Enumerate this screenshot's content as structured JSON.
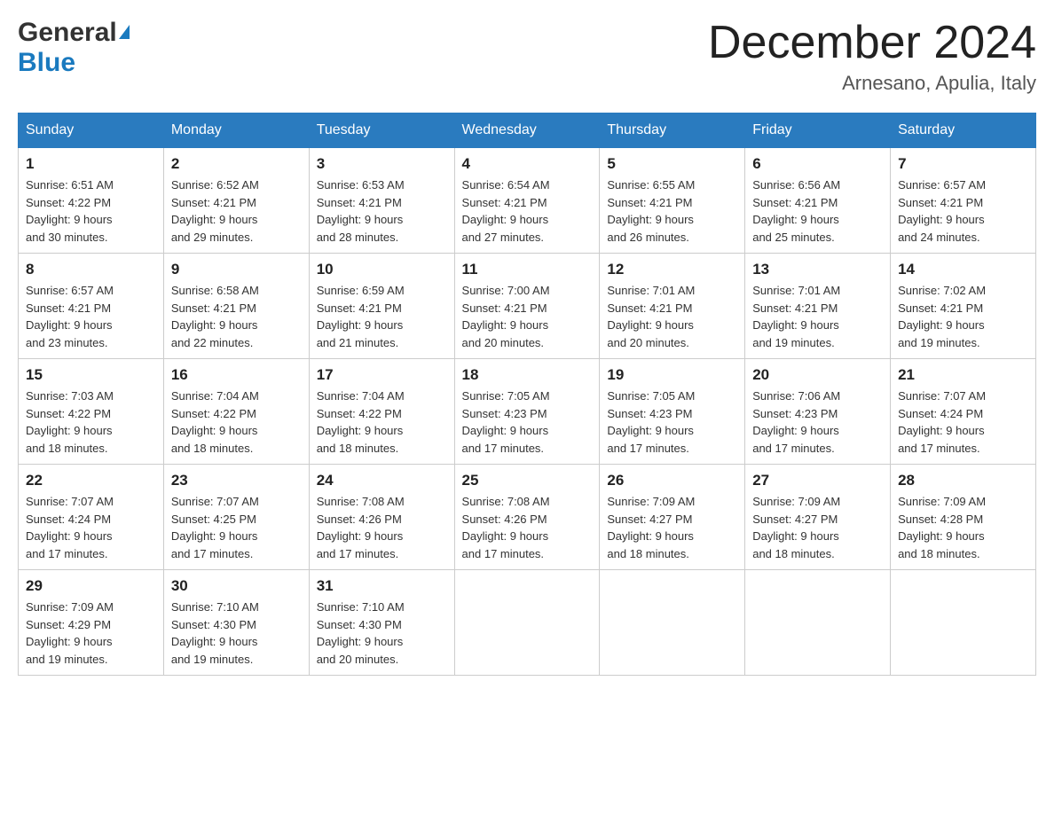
{
  "header": {
    "logo_general": "General",
    "logo_blue": "Blue",
    "month_title": "December 2024",
    "location": "Arnesano, Apulia, Italy"
  },
  "days_of_week": [
    "Sunday",
    "Monday",
    "Tuesday",
    "Wednesday",
    "Thursday",
    "Friday",
    "Saturday"
  ],
  "weeks": [
    [
      {
        "day": "1",
        "sunrise": "6:51 AM",
        "sunset": "4:22 PM",
        "daylight": "9 hours and 30 minutes."
      },
      {
        "day": "2",
        "sunrise": "6:52 AM",
        "sunset": "4:21 PM",
        "daylight": "9 hours and 29 minutes."
      },
      {
        "day": "3",
        "sunrise": "6:53 AM",
        "sunset": "4:21 PM",
        "daylight": "9 hours and 28 minutes."
      },
      {
        "day": "4",
        "sunrise": "6:54 AM",
        "sunset": "4:21 PM",
        "daylight": "9 hours and 27 minutes."
      },
      {
        "day": "5",
        "sunrise": "6:55 AM",
        "sunset": "4:21 PM",
        "daylight": "9 hours and 26 minutes."
      },
      {
        "day": "6",
        "sunrise": "6:56 AM",
        "sunset": "4:21 PM",
        "daylight": "9 hours and 25 minutes."
      },
      {
        "day": "7",
        "sunrise": "6:57 AM",
        "sunset": "4:21 PM",
        "daylight": "9 hours and 24 minutes."
      }
    ],
    [
      {
        "day": "8",
        "sunrise": "6:57 AM",
        "sunset": "4:21 PM",
        "daylight": "9 hours and 23 minutes."
      },
      {
        "day": "9",
        "sunrise": "6:58 AM",
        "sunset": "4:21 PM",
        "daylight": "9 hours and 22 minutes."
      },
      {
        "day": "10",
        "sunrise": "6:59 AM",
        "sunset": "4:21 PM",
        "daylight": "9 hours and 21 minutes."
      },
      {
        "day": "11",
        "sunrise": "7:00 AM",
        "sunset": "4:21 PM",
        "daylight": "9 hours and 20 minutes."
      },
      {
        "day": "12",
        "sunrise": "7:01 AM",
        "sunset": "4:21 PM",
        "daylight": "9 hours and 20 minutes."
      },
      {
        "day": "13",
        "sunrise": "7:01 AM",
        "sunset": "4:21 PM",
        "daylight": "9 hours and 19 minutes."
      },
      {
        "day": "14",
        "sunrise": "7:02 AM",
        "sunset": "4:21 PM",
        "daylight": "9 hours and 19 minutes."
      }
    ],
    [
      {
        "day": "15",
        "sunrise": "7:03 AM",
        "sunset": "4:22 PM",
        "daylight": "9 hours and 18 minutes."
      },
      {
        "day": "16",
        "sunrise": "7:04 AM",
        "sunset": "4:22 PM",
        "daylight": "9 hours and 18 minutes."
      },
      {
        "day": "17",
        "sunrise": "7:04 AM",
        "sunset": "4:22 PM",
        "daylight": "9 hours and 18 minutes."
      },
      {
        "day": "18",
        "sunrise": "7:05 AM",
        "sunset": "4:23 PM",
        "daylight": "9 hours and 17 minutes."
      },
      {
        "day": "19",
        "sunrise": "7:05 AM",
        "sunset": "4:23 PM",
        "daylight": "9 hours and 17 minutes."
      },
      {
        "day": "20",
        "sunrise": "7:06 AM",
        "sunset": "4:23 PM",
        "daylight": "9 hours and 17 minutes."
      },
      {
        "day": "21",
        "sunrise": "7:07 AM",
        "sunset": "4:24 PM",
        "daylight": "9 hours and 17 minutes."
      }
    ],
    [
      {
        "day": "22",
        "sunrise": "7:07 AM",
        "sunset": "4:24 PM",
        "daylight": "9 hours and 17 minutes."
      },
      {
        "day": "23",
        "sunrise": "7:07 AM",
        "sunset": "4:25 PM",
        "daylight": "9 hours and 17 minutes."
      },
      {
        "day": "24",
        "sunrise": "7:08 AM",
        "sunset": "4:26 PM",
        "daylight": "9 hours and 17 minutes."
      },
      {
        "day": "25",
        "sunrise": "7:08 AM",
        "sunset": "4:26 PM",
        "daylight": "9 hours and 17 minutes."
      },
      {
        "day": "26",
        "sunrise": "7:09 AM",
        "sunset": "4:27 PM",
        "daylight": "9 hours and 18 minutes."
      },
      {
        "day": "27",
        "sunrise": "7:09 AM",
        "sunset": "4:27 PM",
        "daylight": "9 hours and 18 minutes."
      },
      {
        "day": "28",
        "sunrise": "7:09 AM",
        "sunset": "4:28 PM",
        "daylight": "9 hours and 18 minutes."
      }
    ],
    [
      {
        "day": "29",
        "sunrise": "7:09 AM",
        "sunset": "4:29 PM",
        "daylight": "9 hours and 19 minutes."
      },
      {
        "day": "30",
        "sunrise": "7:10 AM",
        "sunset": "4:30 PM",
        "daylight": "9 hours and 19 minutes."
      },
      {
        "day": "31",
        "sunrise": "7:10 AM",
        "sunset": "4:30 PM",
        "daylight": "9 hours and 20 minutes."
      },
      null,
      null,
      null,
      null
    ]
  ],
  "labels": {
    "sunrise": "Sunrise:",
    "sunset": "Sunset:",
    "daylight": "Daylight:"
  }
}
